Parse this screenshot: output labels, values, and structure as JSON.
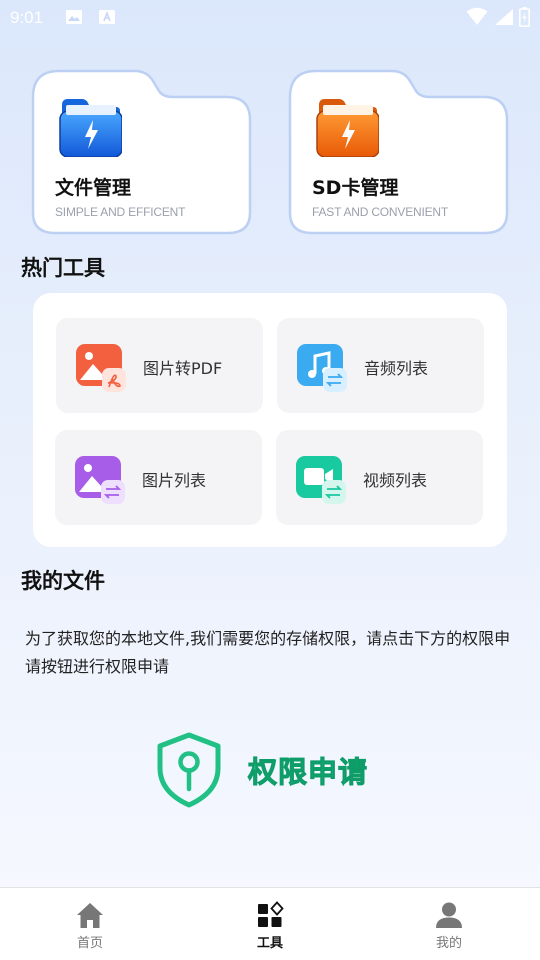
{
  "status_bar": {
    "time": "9:01",
    "icons": [
      "image-icon",
      "font-download-icon",
      "wifi-icon",
      "signal-icon",
      "battery-icon"
    ]
  },
  "storage_cards": [
    {
      "title": "文件管理",
      "subtitle": "SIMPLE AND EFFICENT",
      "icon": "blue-folder-icon",
      "color": "#1f78f0"
    },
    {
      "title": "SD卡管理",
      "subtitle": "FAST AND CONVENIENT",
      "icon": "orange-folder-icon",
      "color": "#f36c0c"
    }
  ],
  "hot_tools": {
    "title": "热门工具",
    "items": [
      {
        "label": "图片转PDF",
        "icon": "image-to-pdf-icon",
        "color": "#f2603f"
      },
      {
        "label": "音频列表",
        "icon": "audio-list-icon",
        "color": "#3aaaf1"
      },
      {
        "label": "图片列表",
        "icon": "image-list-icon",
        "color": "#a75de8"
      },
      {
        "label": "视频列表",
        "icon": "video-list-icon",
        "color": "#19c9a0"
      }
    ]
  },
  "my_files": {
    "title": "我的文件",
    "description": "为了获取您的本地文件,我们需要您的存储权限，请点击下方的权限申请按钮进行权限申请",
    "permission_button": "权限申请",
    "accent": "#21c185"
  },
  "tab_bar": {
    "active": "工具",
    "items": [
      {
        "label": "首页",
        "icon": "home-icon"
      },
      {
        "label": "工具",
        "icon": "tools-icon"
      },
      {
        "label": "我的",
        "icon": "profile-icon"
      }
    ]
  }
}
